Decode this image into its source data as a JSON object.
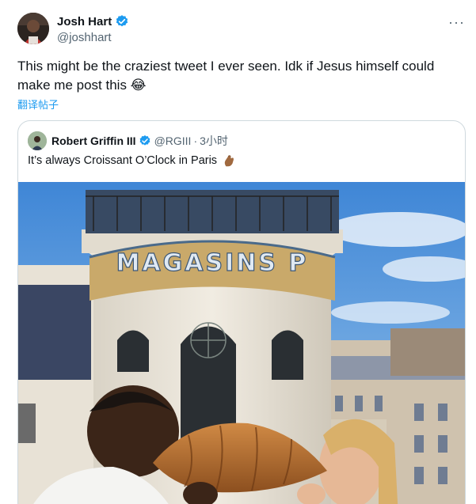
{
  "tweet": {
    "author_name": "Josh Hart",
    "author_handle": "@joshhart",
    "more_label": "···",
    "text": "This might be the craziest tweet I ever seen. Idk if Jesus himself could make me post this 😂",
    "translate_label": "翻译帖子"
  },
  "quote": {
    "author_name": "Robert Griffin III",
    "author_handle": "@RGIII",
    "separator": "·",
    "time": "3小时",
    "text": "It’s always Croissant O’Clock in Paris",
    "media_sign_text": "MAGASINS P"
  },
  "colors": {
    "accent": "#1d9bf0",
    "secondary_text": "#536471",
    "border": "#cfd9de"
  },
  "icons": [
    "verified-badge-icon",
    "more-options-icon",
    "pinched-fingers-emoji-icon"
  ]
}
